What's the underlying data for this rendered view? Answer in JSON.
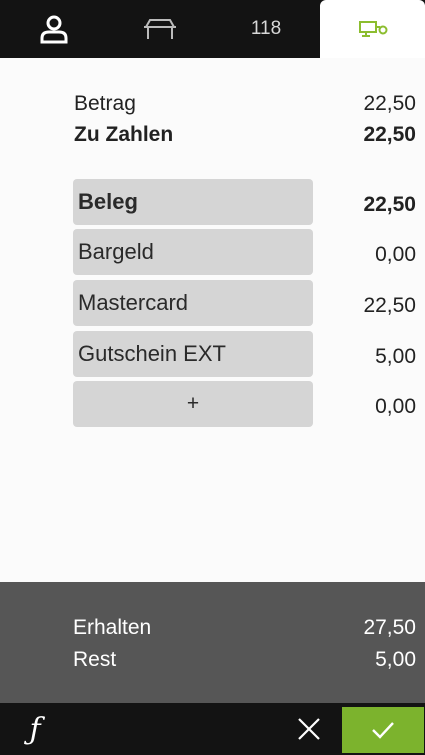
{
  "tabs": {
    "table_number": "118"
  },
  "summary": {
    "amount_label": "Betrag",
    "amount_value": "22,50",
    "to_pay_label": "Zu Zahlen",
    "to_pay_value": "22,50"
  },
  "payments": [
    {
      "label": "Beleg",
      "value": "22,50"
    },
    {
      "label": "Bargeld",
      "value": "0,00"
    },
    {
      "label": "Mastercard",
      "value": "22,50"
    },
    {
      "label": "Gutschein EXT",
      "value": "5,00"
    },
    {
      "label": "+",
      "value": "0,00"
    }
  ],
  "totals": {
    "received_label": "Erhalten",
    "received_value": "27,50",
    "rest_label": "Rest",
    "rest_value": "5,00"
  },
  "footer": {
    "function_label": "ƒ"
  },
  "colors": {
    "accent": "#7cb32d",
    "topbar": "#131313",
    "panel": "#565656",
    "button": "#d5d5d5"
  }
}
